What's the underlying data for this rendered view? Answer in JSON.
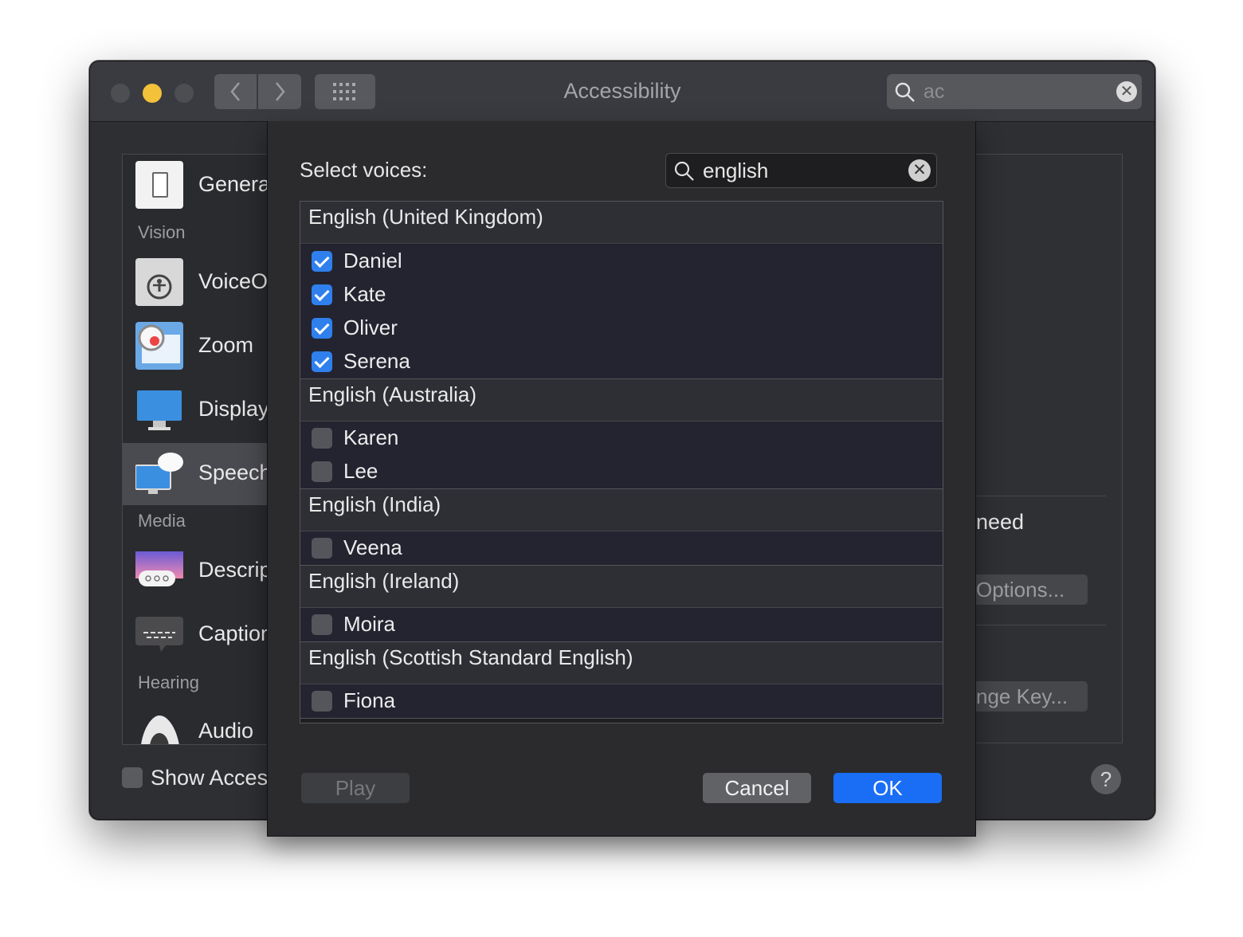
{
  "window": {
    "title": "Accessibility"
  },
  "search": {
    "value": "ac"
  },
  "sidebar": {
    "items": [
      {
        "label": "General"
      },
      {
        "label": "VoiceOver"
      },
      {
        "label": "Zoom"
      },
      {
        "label": "Display"
      },
      {
        "label": "Speech"
      },
      {
        "label": "Descriptions"
      },
      {
        "label": "Captions"
      },
      {
        "label": "Audio"
      }
    ],
    "sections": {
      "vision": "Vision",
      "media": "Media",
      "hearing": "Hearing"
    }
  },
  "footer": {
    "show_accessibility": "Show Accessibility status in menu bar"
  },
  "right_panel": {
    "text_need": "need",
    "options_button": "Options...",
    "change_key_button": "nge Key..."
  },
  "sheet": {
    "title": "Select voices:",
    "search_value": "english",
    "groups": [
      {
        "name": "English (United Kingdom)",
        "voices": [
          {
            "name": "Daniel",
            "checked": true
          },
          {
            "name": "Kate",
            "checked": true
          },
          {
            "name": "Oliver",
            "checked": true
          },
          {
            "name": "Serena",
            "checked": true
          }
        ]
      },
      {
        "name": "English (Australia)",
        "voices": [
          {
            "name": "Karen",
            "checked": false
          },
          {
            "name": "Lee",
            "checked": false
          }
        ]
      },
      {
        "name": "English (India)",
        "voices": [
          {
            "name": "Veena",
            "checked": false
          }
        ]
      },
      {
        "name": "English (Ireland)",
        "voices": [
          {
            "name": "Moira",
            "checked": false
          }
        ]
      },
      {
        "name": "English (Scottish Standard English)",
        "voices": [
          {
            "name": "Fiona",
            "checked": false
          }
        ]
      }
    ],
    "buttons": {
      "play": "Play",
      "cancel": "Cancel",
      "ok": "OK"
    }
  },
  "icons": {
    "back": "chevron-left-icon",
    "forward": "chevron-right-icon",
    "grid": "grid-icon",
    "search": "search-icon",
    "clear": "clear-icon",
    "help": "question-mark"
  },
  "colors": {
    "accent": "#1a6ef5",
    "checkbox_on": "#2f80ed",
    "minimize": "#f3c23a"
  }
}
